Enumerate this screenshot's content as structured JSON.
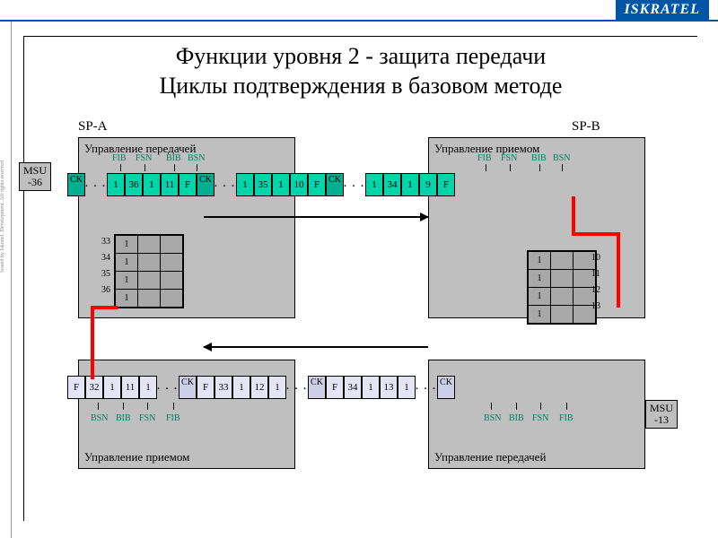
{
  "brand": "ISKRATEL",
  "sidenote": "Issued by Iskratel. Development. All rights reserved",
  "title1": "Функции уровня 2 - защита передачи",
  "title2": "Циклы подтверждения в базовом методе",
  "spA": "SP-A",
  "spB": "SP-B",
  "panels": {
    "txA": "Управление передачей",
    "rxB": "Управление приемом",
    "rxA": "Управление приемом",
    "txB": "Управление передачей"
  },
  "hdrTop": {
    "c1": "FIB",
    "c2": "FSN",
    "c3": "BIB",
    "c4": "BSN"
  },
  "hdrBot": {
    "c1": "BSN",
    "c2": "BIB",
    "c3": "FSN",
    "c4": "FIB"
  },
  "msu36": {
    "l1": "MSU",
    "l2": "-36"
  },
  "msu13": {
    "l1": "MSU",
    "l2": "-13"
  },
  "ck": "CK",
  "F": "F",
  "dots": ". . .",
  "g1": {
    "a": "1",
    "b": "36",
    "c": "1",
    "d": "11"
  },
  "g2": {
    "a": "1",
    "b": "35",
    "c": "1",
    "d": "10"
  },
  "g3": {
    "a": "1",
    "b": "34",
    "c": "1",
    "d": "9"
  },
  "l1": {
    "a": "32",
    "b": "1",
    "c": "11",
    "d": "1"
  },
  "l2": {
    "a": "33",
    "b": "1",
    "c": "12",
    "d": "1"
  },
  "l3": {
    "a": "34",
    "b": "1",
    "c": "13",
    "d": "1"
  },
  "gridA": {
    "r": [
      "33",
      "34",
      "35",
      "36"
    ],
    "vals": [
      "1",
      "1",
      "1",
      "1"
    ]
  },
  "gridB": {
    "r": [
      "10",
      "11",
      "12",
      "13"
    ],
    "vals": [
      "1",
      "1",
      "1",
      "1"
    ]
  }
}
